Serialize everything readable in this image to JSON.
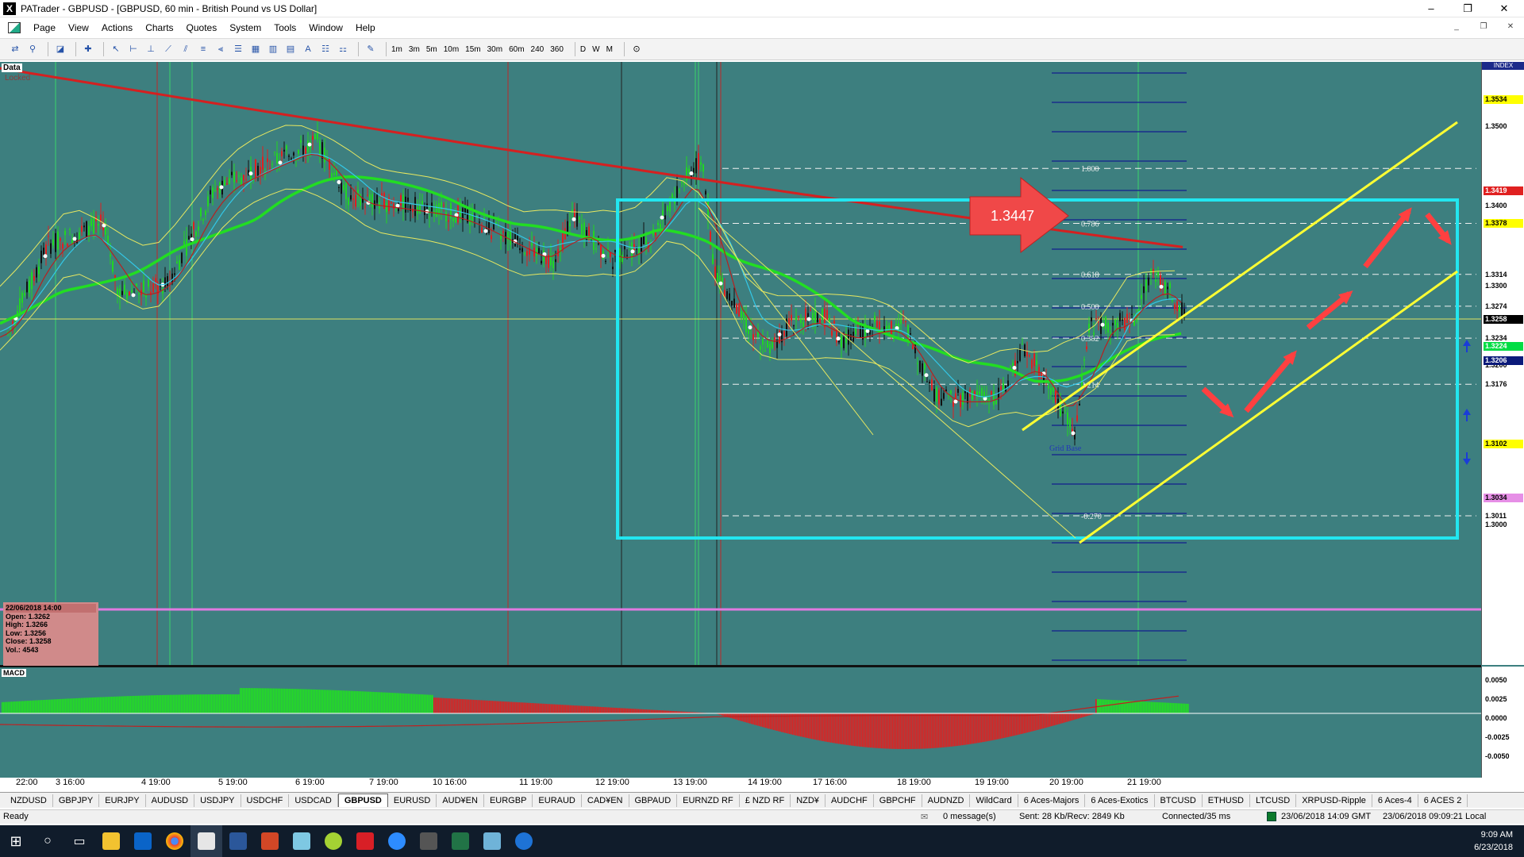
{
  "window": {
    "title": "PATrader - GBPUSD - [GBPUSD, 60 min - British Pound vs US Dollar]",
    "app_icon": "X",
    "minimize": "–",
    "maximize": "❐",
    "close": "✕"
  },
  "menu": [
    "Page",
    "View",
    "Actions",
    "Charts",
    "Quotes",
    "System",
    "Tools",
    "Window",
    "Help"
  ],
  "mdi_controls": [
    "_",
    "❐",
    "✕"
  ],
  "toolbar": {
    "tool_icons": [
      "chart-cross-icon",
      "chart-pin-icon",
      "chart-type-icon",
      "crosshair-icon",
      "pointer-icon",
      "hline-icon",
      "vline-icon",
      "trendline-icon",
      "channel-icon",
      "fibonacci-icon",
      "fib-fan-icon",
      "fib-arc-icon",
      "grid-icon",
      "cycles-icon",
      "rectangle-icon",
      "text-icon",
      "annotation-icon",
      "pattern-icon",
      "draw-icon"
    ],
    "timeframes": [
      "1m",
      "3m",
      "5m",
      "10m",
      "15m",
      "30m",
      "60m",
      "240",
      "360",
      "D",
      "W",
      "M"
    ],
    "clock_icon": "⊙"
  },
  "chart": {
    "data_label": "Data",
    "locked_label": "Locked",
    "callout_price": "1.3447",
    "grid_base_label": "Grid Base",
    "fib_levels": [
      {
        "label": "1.000",
        "price": 1.3447
      },
      {
        "label": "0.786",
        "price": 1.3378
      },
      {
        "label": "0.618",
        "price": 1.3314
      },
      {
        "label": "0.500",
        "price": 1.3274
      },
      {
        "label": "0.382",
        "price": 1.3234
      },
      {
        "label": "0.214",
        "price": 1.3176
      },
      {
        "label": "-0.270",
        "price": 1.3011
      }
    ],
    "price_axis": {
      "index_label": "INDEX",
      "ticks": [
        "1.3500",
        "1.3400",
        "1.3300",
        "1.3200",
        "1.3000"
      ],
      "markers": [
        {
          "text": "1.3534",
          "bg": "#ffff00",
          "fg": "#000000"
        },
        {
          "text": "1.3419",
          "bg": "#e02020",
          "fg": "#ffffff"
        },
        {
          "text": "1.3378",
          "bg": "#ffff00",
          "fg": "#000000"
        },
        {
          "text": "1.3314",
          "bg": "#ffffff",
          "fg": "#000000"
        },
        {
          "text": "1.3274",
          "bg": "#ffffff",
          "fg": "#000000"
        },
        {
          "text": "1.3258",
          "bg": "#000000",
          "fg": "#ffffff"
        },
        {
          "text": "1.3234",
          "bg": "#ffffff",
          "fg": "#000000"
        },
        {
          "text": "1.3224",
          "bg": "#00dd44",
          "fg": "#ffffff"
        },
        {
          "text": "1.3206",
          "bg": "#0b1a7a",
          "fg": "#ffffff"
        },
        {
          "text": "1.3176",
          "bg": "#ffffff",
          "fg": "#000000"
        },
        {
          "text": "1.3102",
          "bg": "#ffff00",
          "fg": "#000000"
        },
        {
          "text": "1.3034",
          "bg": "#e68fe6",
          "fg": "#000000"
        },
        {
          "text": "1.3011",
          "bg": "#ffffff",
          "fg": "#000000"
        }
      ]
    },
    "ohlc_box": {
      "datetime": "22/06/2018 14:00",
      "open": "Open: 1.3262",
      "high": "High: 1.3266",
      "low": "Low: 1.3256",
      "close": "Close: 1.3258",
      "vol": "Vol.: 4543"
    },
    "macd": {
      "label": "MACD",
      "ticks": [
        "0.0050",
        "0.0025",
        "0.0000",
        "-0.0025",
        "-0.0050"
      ]
    },
    "time_axis": [
      "22:00",
      "3 16:00",
      "4 19:00",
      "5 19:00",
      "6 19:00",
      "7 19:00",
      "10 16:00",
      "11 19:00",
      "12 19:00",
      "13 19:00",
      "14 19:00",
      "17 16:00",
      "18 19:00",
      "19 19:00",
      "20 19:00",
      "21 19:00"
    ],
    "colors": {
      "background": "#3d7f7f",
      "ema_red": "#d42020",
      "ema_green": "#22dd22",
      "box_cyan": "#22e6f0",
      "channel_yellow": "#ffff33",
      "arrow_red": "#ff4040"
    }
  },
  "symbols": [
    "NZDUSD",
    "GBPJPY",
    "EURJPY",
    "AUDUSD",
    "USDJPY",
    "USDCHF",
    "USDCAD",
    "GBPUSD",
    "EURUSD",
    "AUD¥EN",
    "EURGBP",
    "EURAUD",
    "CAD¥EN",
    "GBPAUD",
    "EURNZD RF",
    "£ NZD RF",
    "NZD¥",
    "AUDCHF",
    "GBPCHF",
    "AUDNZD",
    "WildCard",
    "6 Aces-Majors",
    "6 Aces-Exotics",
    "BTCUSD",
    "ETHUSD",
    "LTCUSD",
    "XRPUSD-Ripple",
    "6 Aces-4",
    "6 ACES 2"
  ],
  "active_symbol": "GBPUSD",
  "status": {
    "ready": "Ready",
    "messages": "0 message(s)",
    "traffic": "Sent: 28 Kb/Recv: 2849 Kb",
    "connection": "Connected/35 ms",
    "gmt_time": "23/06/2018 14:09 GMT",
    "local_time": "23/06/2018 09:09:21 Local"
  },
  "taskbar": {
    "time": "9:09 AM",
    "date": "6/23/2018",
    "apps": [
      "start-icon",
      "search-icon",
      "task-view-icon",
      "file-explorer-icon",
      "outlook-icon",
      "chrome-icon",
      "patrader-icon",
      "word-icon",
      "powerpoint-icon",
      "notes-icon",
      "n-app-icon",
      "red-app-icon",
      "zoom-icon",
      "calculator-icon",
      "excel-icon",
      "picture-icon",
      "edge-icon"
    ]
  }
}
